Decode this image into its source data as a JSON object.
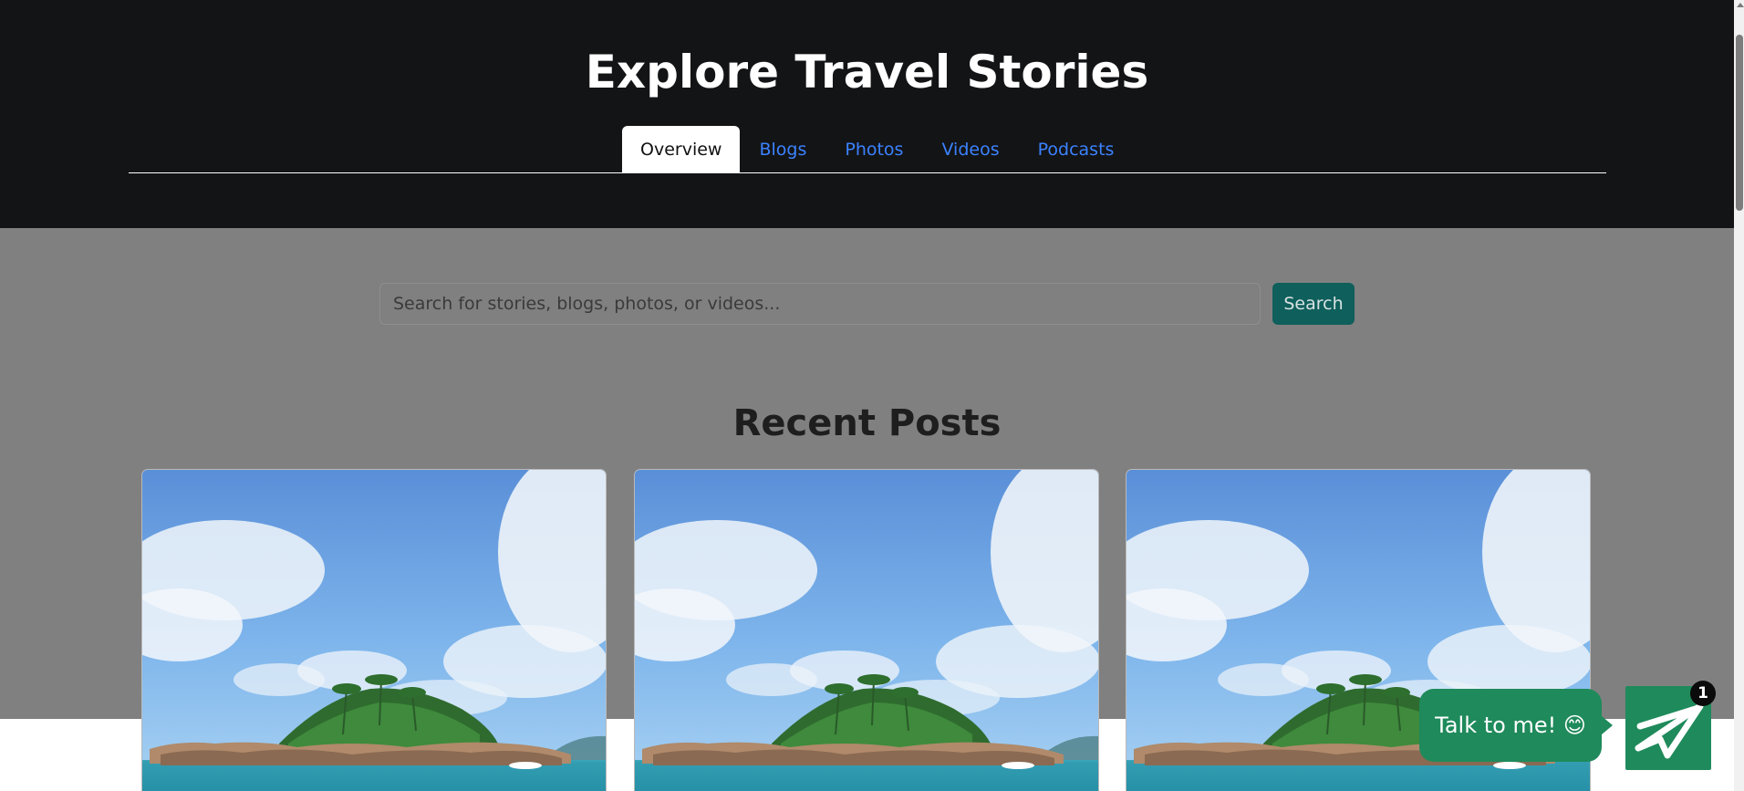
{
  "header": {
    "title": "Explore Travel Stories",
    "tabs": [
      {
        "label": "Overview",
        "active": true
      },
      {
        "label": "Blogs",
        "active": false
      },
      {
        "label": "Photos",
        "active": false
      },
      {
        "label": "Videos",
        "active": false
      },
      {
        "label": "Podcasts",
        "active": false
      }
    ]
  },
  "search": {
    "placeholder": "Search for stories, blogs, photos, or videos...",
    "value": "",
    "button_label": "Search"
  },
  "recent_posts": {
    "title": "Recent Posts",
    "cards": [
      {
        "image_icon": "tropical-island-image"
      },
      {
        "image_icon": "tropical-island-image"
      },
      {
        "image_icon": "tropical-island-image"
      }
    ]
  },
  "chat": {
    "bubble_text": "Talk to me! 😊",
    "badge_count": "1",
    "launcher_icon": "paper-plane-icon"
  },
  "colors": {
    "header_bg": "#131416",
    "overlay_bg": "#808080",
    "tab_link": "#3b82ff",
    "search_button": "#0f5f5c",
    "chat_green": "#1f8a5b"
  }
}
